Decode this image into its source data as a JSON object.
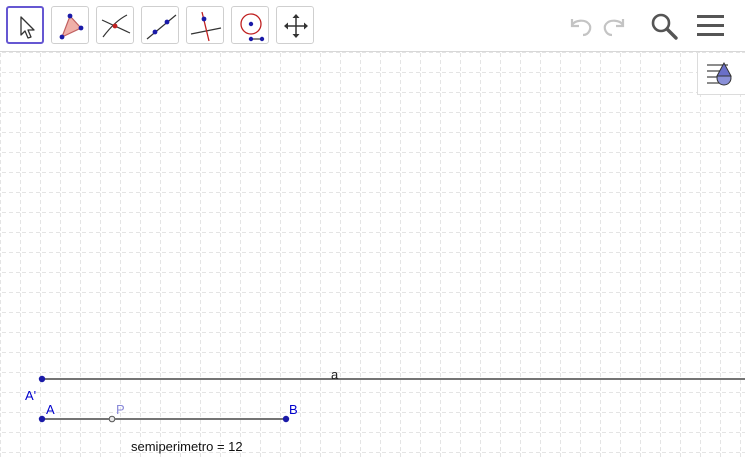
{
  "toolbar": {
    "tools": [
      {
        "name": "move",
        "icon": "arrow-pointer-icon",
        "selected": true
      },
      {
        "name": "polygon",
        "icon": "triangle-icon",
        "selected": false
      },
      {
        "name": "intersect",
        "icon": "intersect-icon",
        "selected": false
      },
      {
        "name": "line",
        "icon": "line-through-points-icon",
        "selected": false
      },
      {
        "name": "perpendicular",
        "icon": "perpendicular-line-icon",
        "selected": false
      },
      {
        "name": "circle",
        "icon": "circle-point-icon",
        "selected": false
      },
      {
        "name": "move-view",
        "icon": "move-graphics-view-icon",
        "selected": false
      }
    ],
    "right_icons": [
      "undo-icon",
      "redo-icon",
      "search-icon",
      "menu-icon"
    ]
  },
  "graphics": {
    "style_bar_icon": "style-bar-toggle-icon",
    "labels": {
      "line_a": "a",
      "point_a_prime": "A'",
      "point_a": "A",
      "point_p": "P",
      "point_b": "B",
      "semiperimeter": "semiperimetro = 12"
    }
  },
  "colors": {
    "accent": "#6557d2",
    "point": "#1a1aa8",
    "label_blue": "#0000cc",
    "point_p": "#8888d8",
    "grid": "#c8c8c8"
  }
}
